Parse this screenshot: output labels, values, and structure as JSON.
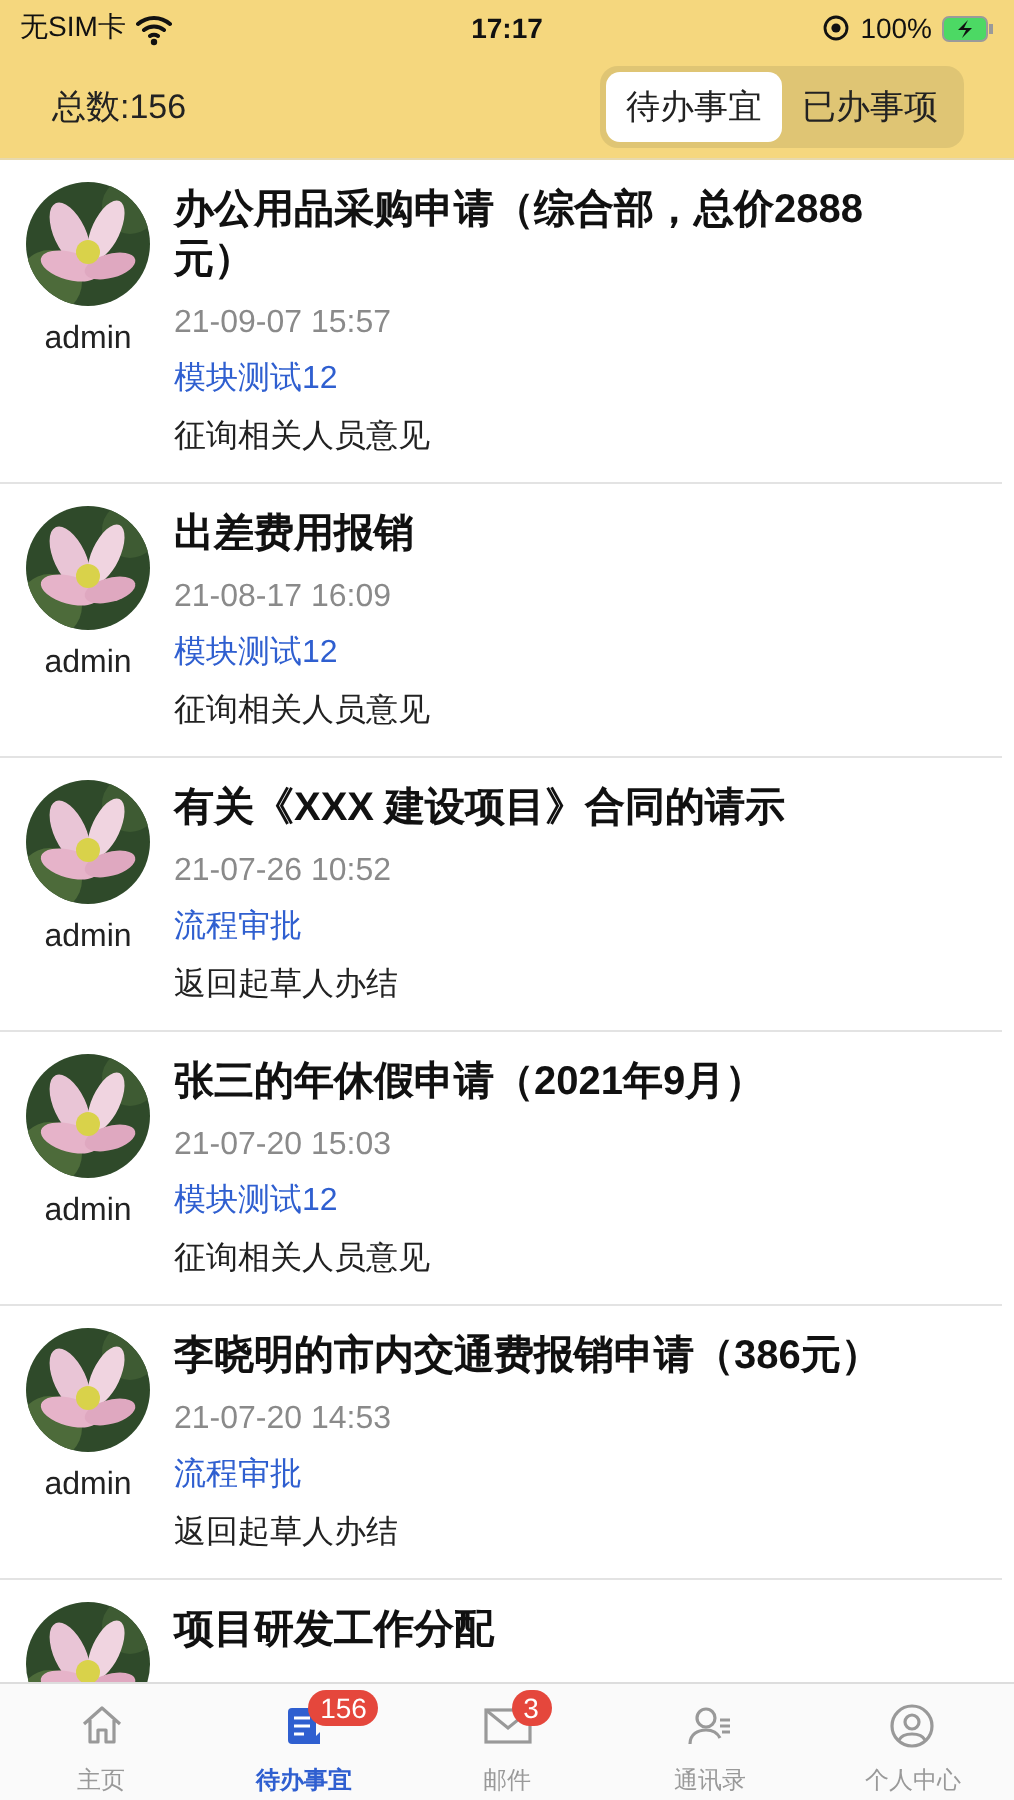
{
  "status_bar": {
    "carrier": "无SIM卡",
    "time": "17:17",
    "battery": "100%"
  },
  "header": {
    "total": "总数:156",
    "segments": [
      {
        "label": "待办事宜",
        "selected": true
      },
      {
        "label": "已办事项",
        "selected": false
      }
    ]
  },
  "tasks": [
    {
      "author": "admin",
      "title": "办公用品采购申请（综合部，总价2888元）",
      "date": "21-09-07 15:57",
      "process": "模块测试12",
      "step": "征询相关人员意见"
    },
    {
      "author": "admin",
      "title": "出差费用报销",
      "date": "21-08-17 16:09",
      "process": "模块测试12",
      "step": "征询相关人员意见"
    },
    {
      "author": "admin",
      "title": "有关《XXX 建设项目》合同的请示",
      "date": "21-07-26 10:52",
      "process": "流程审批",
      "step": "返回起草人办结"
    },
    {
      "author": "admin",
      "title": "张三的年休假申请（2021年9月）",
      "date": "21-07-20 15:03",
      "process": "模块测试12",
      "step": "征询相关人员意见"
    },
    {
      "author": "admin",
      "title": "李晓明的市内交通费报销申请（386元）",
      "date": "21-07-20 14:53",
      "process": "流程审批",
      "step": "返回起草人办结"
    },
    {
      "title": "项目研发工作分配"
    }
  ],
  "tab_bar": [
    {
      "kind": "home",
      "label": "主页",
      "selected": false
    },
    {
      "kind": "todo",
      "label": "待办事宜",
      "selected": true,
      "badge": "156"
    },
    {
      "kind": "mail",
      "label": "邮件",
      "selected": false,
      "badge": "3"
    },
    {
      "kind": "contacts",
      "label": "通讯录",
      "selected": false
    },
    {
      "kind": "profile",
      "label": "个人中心",
      "selected": false
    }
  ]
}
